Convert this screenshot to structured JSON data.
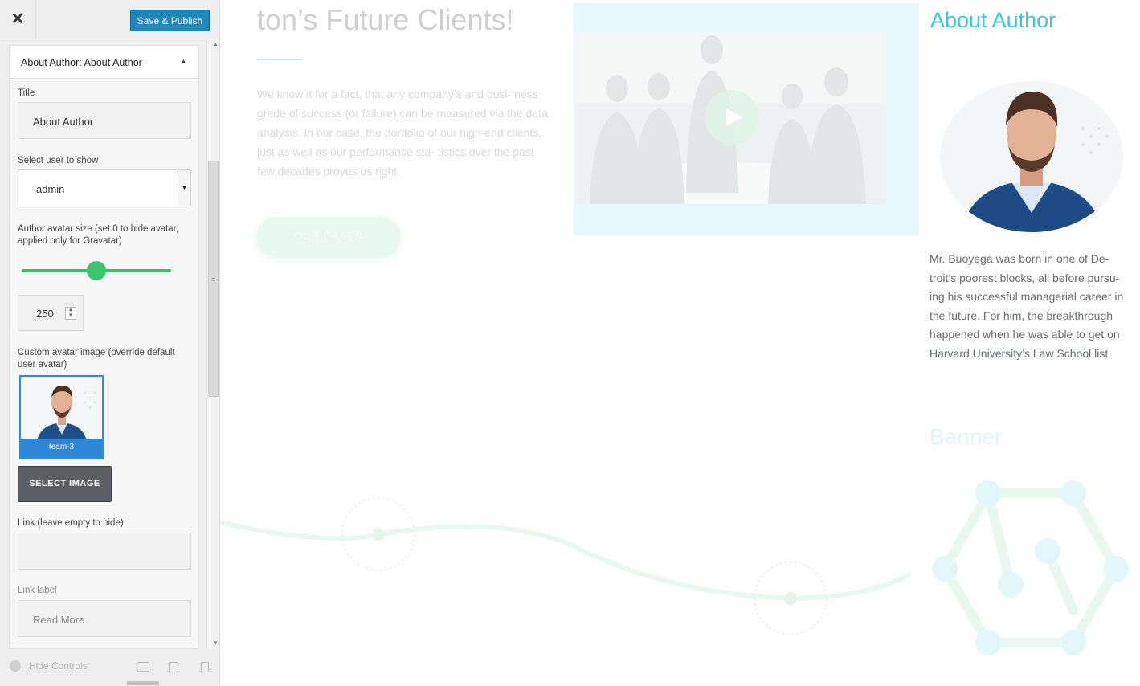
{
  "sidebar": {
    "close_icon": "close-icon",
    "publish_label": "Save & Publish",
    "panel": {
      "title_prefix": "About Author:",
      "title_value": "About Author"
    },
    "fields": {
      "title_label": "Title",
      "title_value": "About Author",
      "user_label": "Select user to show",
      "user_value": "admin",
      "avatar_size_label": "Author avatar size (set 0 to hide avatar, applied only for Gravatar)",
      "avatar_size_value": "250",
      "avatar_size_slider_fraction": 0.5,
      "custom_avatar_label": "Custom avatar image (override default user avatar)",
      "avatar_filename": "team-3",
      "select_image_label": "SELECT IMAGE",
      "link_label": "Link (leave empty to hide)",
      "link_value": "",
      "link_label_label": "Link label",
      "link_label_value": "Read More"
    },
    "footer": {
      "hide_controls": "Hide Controls",
      "devices": [
        "desktop-icon",
        "tablet-icon",
        "mobile-icon"
      ]
    }
  },
  "preview": {
    "headline": "ton’s Future Clients!",
    "paragraph": "We know it for a fact, that any company’s and busi- ness grade of success (or failure) can be measured via the data analysis. In our case, the portfolio of our high-end clients, just as well as our performance sta- tistics over the past few decades proves us right.",
    "cases_button": "OUR CASES",
    "about_title": "About Author",
    "bio": "Mr. Buoyega was born in one of De- troit’s poorest blocks, all before pursu- ing his successful managerial career in the future. For him, the breakthrough happened when he was able to get on Harvard University’s Law School list.",
    "banner_title": "Banner"
  },
  "colors": {
    "publish": "#1e86ba",
    "slider": "#3ec46d",
    "accent": "#3fc7e0",
    "select_image": "#5b5e63"
  }
}
